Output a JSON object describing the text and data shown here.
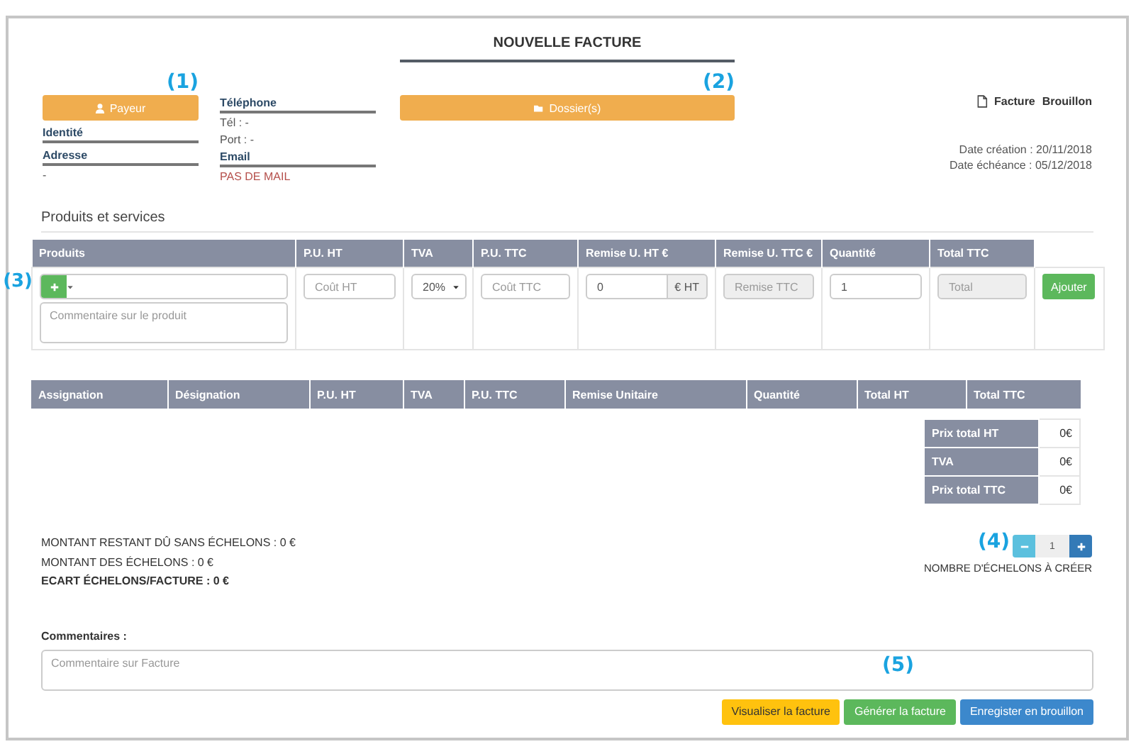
{
  "title": "NOUVELLE FACTURE",
  "payer": {
    "button": "Payeur",
    "callout": "(1)",
    "identity_label": "Identité",
    "address_label": "Adresse",
    "address_value": "-"
  },
  "contact": {
    "phone_label": "Téléphone",
    "tel": "Tél : -",
    "port": "Port : -",
    "email_label": "Email",
    "email_value": "PAS DE MAIL"
  },
  "folder": {
    "button": "Dossier(s)",
    "callout": "(2)"
  },
  "document": {
    "type": "Facture",
    "status": "Brouillon",
    "created": "Date création : 20/11/2018",
    "due": "Date échéance : 05/12/2018"
  },
  "products": {
    "heading": "Produits et services",
    "callout": "(3)",
    "columns": [
      "Produits",
      "P.U. HT",
      "TVA",
      "P.U. TTC",
      "Remise U. HT €",
      "Remise U. TTC €",
      "Quantité",
      "Total TTC"
    ],
    "entry": {
      "comment": {
        "placeholder": "Commentaire sur le produit"
      },
      "pu_ht": {
        "placeholder": "Coût HT",
        "disabled": false
      },
      "tva": {
        "value": "20%"
      },
      "pu_ttc": {
        "placeholder": "Coût TTC",
        "disabled": false
      },
      "discount_ht": {
        "value": "0",
        "unit": "€ HT"
      },
      "discount_ttc": {
        "placeholder": "Remise TTC",
        "disabled": true
      },
      "quantity": {
        "value": "1",
        "disabled": false
      },
      "total": {
        "placeholder": "Total",
        "disabled": true
      },
      "add_button": "Ajouter"
    }
  },
  "lines": {
    "columns": [
      "Assignation",
      "Désignation",
      "P.U. HT",
      "TVA",
      "P.U. TTC",
      "Remise Unitaire",
      "Quantité",
      "Total HT",
      "Total TTC"
    ]
  },
  "totals": [
    {
      "label": "Prix total HT",
      "value": "0€"
    },
    {
      "label": "TVA",
      "value": "0€"
    },
    {
      "label": "Prix total TTC",
      "value": "0€"
    }
  ],
  "summary": [
    {
      "text": "MONTANT RESTANT DÛ SANS ÉCHELONS : 0 €",
      "bold": false
    },
    {
      "text": "MONTANT DES ÉCHELONS : 0 €",
      "bold": false
    },
    {
      "text": "ECART ÉCHELONS/FACTURE : 0 €",
      "bold": true
    }
  ],
  "installments": {
    "callout": "(4)",
    "value": "1",
    "label": "NOMBRE D'ÉCHELONS À CRÉER"
  },
  "comments": {
    "label": "Commentaires :",
    "placeholder": "Commentaire sur Facture",
    "callout": "(5)"
  },
  "actions": [
    {
      "label": "Visualiser la facture",
      "kind": "warning"
    },
    {
      "label": "Générer la facture",
      "kind": "success"
    },
    {
      "label": "Enregister en brouillon",
      "kind": "primary"
    }
  ]
}
